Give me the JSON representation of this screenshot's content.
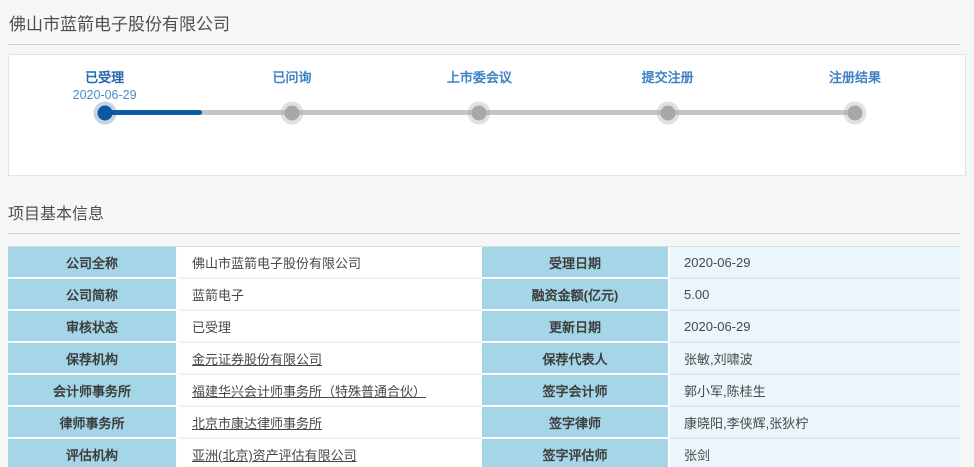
{
  "page": {
    "title": "佛山市蓝箭电子股份有限公司",
    "section_title": "项目基本信息"
  },
  "colors": {
    "accent_blue": "#0e5ca3",
    "step_label_blue": "#3e82c5",
    "label_cell_bg": "#a5d6e8",
    "value_cell_bg_right": "#eaf6fb",
    "track_gray": "#c5c5c5"
  },
  "timeline": {
    "steps": [
      {
        "label": "已受理",
        "date": "2020-06-29",
        "state": "active"
      },
      {
        "label": "已问询",
        "date": "",
        "state": "pending"
      },
      {
        "label": "上市委会议",
        "date": "",
        "state": "pending"
      },
      {
        "label": "提交注册",
        "date": "",
        "state": "pending"
      },
      {
        "label": "注册结果",
        "date": "",
        "state": "pending"
      }
    ]
  },
  "info_table": {
    "rows": [
      {
        "left_label": "公司全称",
        "left_value": "佛山市蓝箭电子股份有限公司",
        "right_label": "受理日期",
        "right_value": "2020-06-29"
      },
      {
        "left_label": "公司简称",
        "left_value": "蓝箭电子",
        "right_label": "融资金额(亿元)",
        "right_value": "5.00"
      },
      {
        "left_label": "审核状态",
        "left_value": "已受理",
        "right_label": "更新日期",
        "right_value": "2020-06-29"
      },
      {
        "left_label": "保荐机构",
        "left_value": "金元证券股份有限公司",
        "right_label": "保荐代表人",
        "right_value": "张敏,刘啸波"
      },
      {
        "left_label": "会计师事务所",
        "left_value": "福建华兴会计师事务所（特殊普通合伙）",
        "right_label": "签字会计师",
        "right_value": "郭小军,陈桂生"
      },
      {
        "left_label": "律师事务所",
        "left_value": "北京市康达律师事务所",
        "right_label": "签字律师",
        "right_value": "康晓阳,李侠辉,张狄柠"
      },
      {
        "left_label": "评估机构",
        "left_value": "亚洲(北京)资产评估有限公司",
        "right_label": "签字评估师",
        "right_value": "张剑"
      }
    ]
  }
}
